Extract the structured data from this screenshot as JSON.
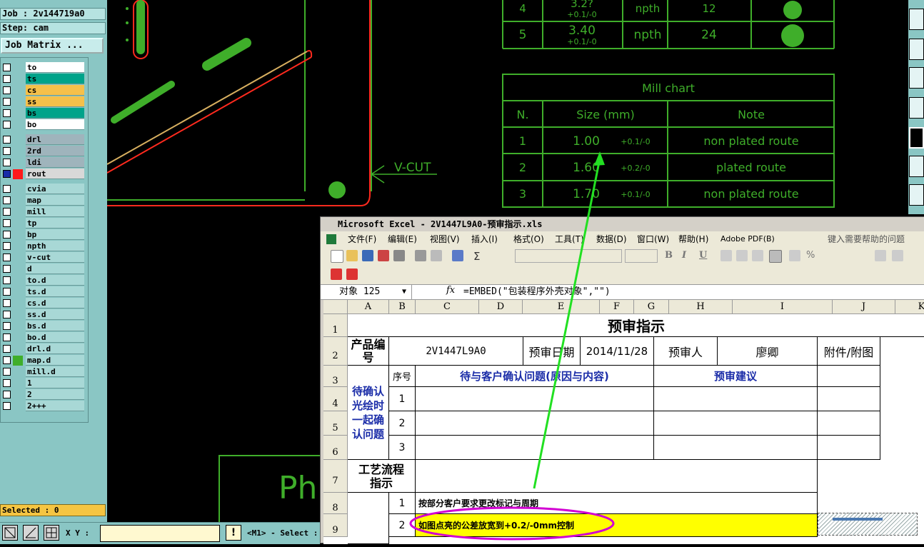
{
  "job_panel": {
    "job_label": "Job : 2v144719a0",
    "step_label": "Step: cam",
    "matrix_button": "Job Matrix ...",
    "layers_board": [
      {
        "name": "to",
        "color": "#ffffff"
      },
      {
        "name": "ts",
        "color": "#00a38a"
      },
      {
        "name": "cs",
        "color": "#f5c04a"
      },
      {
        "name": "ss",
        "color": "#f5c04a"
      },
      {
        "name": "bs",
        "color": "#00a38a"
      },
      {
        "name": "bo",
        "color": "#ffffff"
      }
    ],
    "layers_drill": [
      {
        "name": "drl",
        "color": "#9fb4bc"
      },
      {
        "name": "2rd",
        "color": "#9fb4bc"
      },
      {
        "name": "ldi",
        "color": "#9fb4bc"
      },
      {
        "name": "rout",
        "color": "#d8d8d8"
      }
    ],
    "layers_misc": [
      "cvia",
      "map",
      "mill",
      "tp",
      "bp",
      "npth",
      "v-cut",
      "d",
      "to.d",
      "ts.d",
      "cs.d",
      "ss.d",
      "bs.d",
      "bo.d",
      "drl.d",
      "map.d",
      "mill.d",
      "1",
      "2",
      "2+++"
    ],
    "selected_label": "Selected : 0"
  },
  "bottom_bar": {
    "xy_label": "X Y :",
    "xy_value": "",
    "mode_label": "<M1> - Select :"
  },
  "cad": {
    "vcut_label": "V-CUT",
    "ph_text": "Ph",
    "drill_rows": [
      {
        "n": "4",
        "size": "3.2?",
        "tol": "+0.1/-0",
        "type": "npth",
        "count": "12"
      },
      {
        "n": "5",
        "size": "3.40",
        "tol": "+0.1/-0",
        "type": "npth",
        "count": "24"
      }
    ],
    "mill_chart": {
      "title": "Mill chart",
      "headers": [
        "N.",
        "Size (mm)",
        "Note"
      ],
      "rows": [
        {
          "n": "1",
          "size": "1.00",
          "tol": "+0.1/-0",
          "note": "non plated route"
        },
        {
          "n": "2",
          "size": "1.60",
          "tol": "+0.2/-0",
          "note": "plated route"
        },
        {
          "n": "3",
          "size": "1.70",
          "tol": "+0.1/-0",
          "note": "non plated route"
        }
      ]
    }
  },
  "excel": {
    "title": "Microsoft Excel - 2V1447L9A0-预审指示.xls",
    "menu": [
      "文件(F)",
      "编辑(E)",
      "视图(V)",
      "插入(I)",
      "格式(O)",
      "工具(T)",
      "数据(D)",
      "窗口(W)",
      "帮助(H)",
      "Adobe PDF(B)"
    ],
    "help_placeholder": "键入需要帮助的问题",
    "name_box": "对象 125",
    "fx": "fx",
    "formula": "=EMBED(\"包装程序外壳对象\",\"\")",
    "columns": [
      "A",
      "B",
      "C",
      "D",
      "E",
      "F",
      "G",
      "H",
      "I",
      "J",
      "K"
    ],
    "rows": [
      "1",
      "2",
      "3",
      "4",
      "5",
      "6",
      "7",
      "8",
      "9"
    ],
    "sheet": {
      "title": "预审指示",
      "product_label": "产品编号",
      "product_no": "2V1447L9A0",
      "date_label": "预审日期",
      "date": "2014/11/28",
      "reviewer_label": "预审人",
      "reviewer": "廖卿",
      "attach_label": "附件/附图",
      "seq_label": "序号",
      "issue_header": "待与客户确认问题(原因与内容)",
      "suggest_header": "预审建议",
      "confirm_label": "待确认光绘时一起确认问题",
      "q1": "1",
      "q2": "2",
      "q3": "3",
      "process_label": "工艺流程指示",
      "p1": "1",
      "p1_text": "按部分客户要求更改标记与周期",
      "p2": "2",
      "p2_text": "如图点亮的公差放宽到+0.2/-0mm控制"
    }
  }
}
